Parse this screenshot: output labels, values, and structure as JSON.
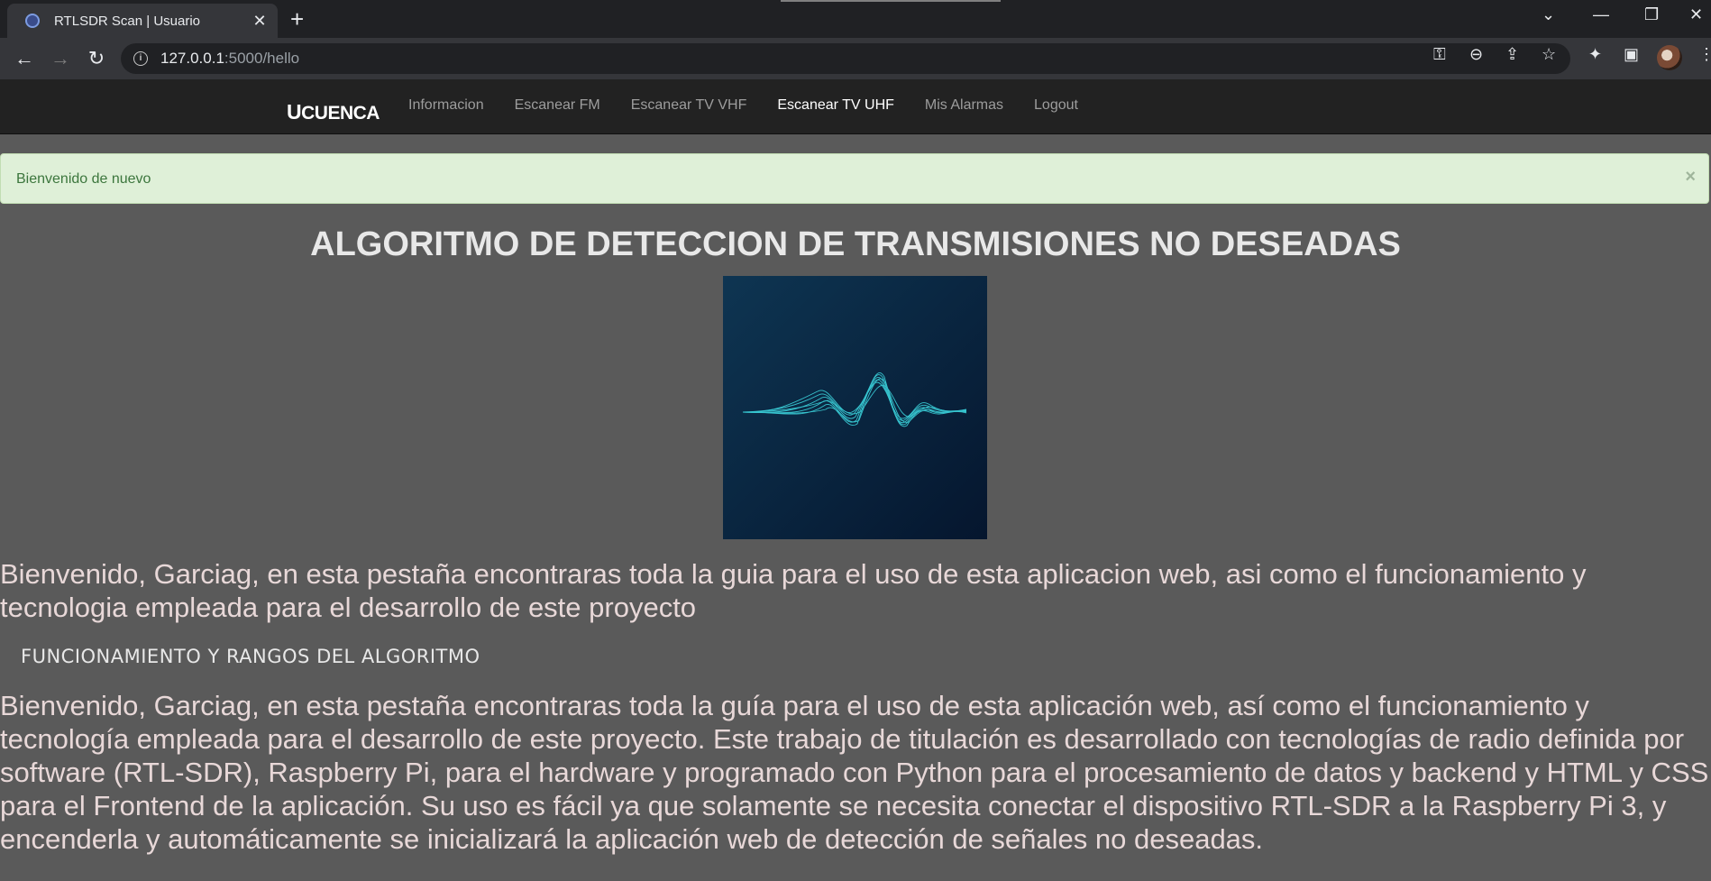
{
  "browser": {
    "tab_title": "RTLSDR Scan | Usuario",
    "url_host": "127.0.0.1",
    "url_path": ":5000/hello"
  },
  "nav": {
    "brand_u": "U",
    "brand_rest": "CUENCA",
    "links": [
      "Informacion",
      "Escanear FM",
      "Escanear TV VHF",
      "Escanear TV UHF",
      "Mis Alarmas",
      "Logout"
    ]
  },
  "alert": {
    "message": "Bienvenido de nuevo",
    "close": "×"
  },
  "main": {
    "heading": "ALGORITMO DE DETECCION DE TRANSMISIONES NO DESEADAS",
    "intro": "Bienvenido, Garciag, en esta pestaña encontraras toda la guia para el uso de esta aplicacion web, asi como el funcionamiento y tecnologia empleada para el desarrollo de este proyecto",
    "section_title": "FUNCIONAMIENTO Y RANGOS DEL ALGORITMO",
    "body": "Bienvenido, Garciag, en esta pestaña encontraras toda la guía para el uso de esta aplicación web, así como el funcionamiento y tecnología empleada para el desarrollo de este proyecto. Este trabajo de titulación es desarrollado con tecnologías de radio definida por software (RTL-SDR), Raspberry Pi, para el hardware y programado con Python para el procesamiento de datos y backend y HTML y CSS para el Frontend de la aplicación. Su uso es fácil ya que solamente se necesita conectar el dispositivo RTL-SDR a la Raspberry Pi 3, y encenderla y automáticamente se inicializará la aplicación web de detección de señales no deseadas."
  },
  "colors": {
    "page_bg": "#5a5a5a",
    "navbar_bg": "#222222",
    "alert_bg": "#dff0d8",
    "alert_text": "#3c763d",
    "wave": "#3fe0e8"
  },
  "icons": [
    "info-icon",
    "key-icon",
    "zoom-out-icon",
    "share-icon",
    "star-icon",
    "extensions-icon",
    "sidepanel-icon",
    "menu-icon",
    "back-icon",
    "forward-icon",
    "reload-icon"
  ]
}
